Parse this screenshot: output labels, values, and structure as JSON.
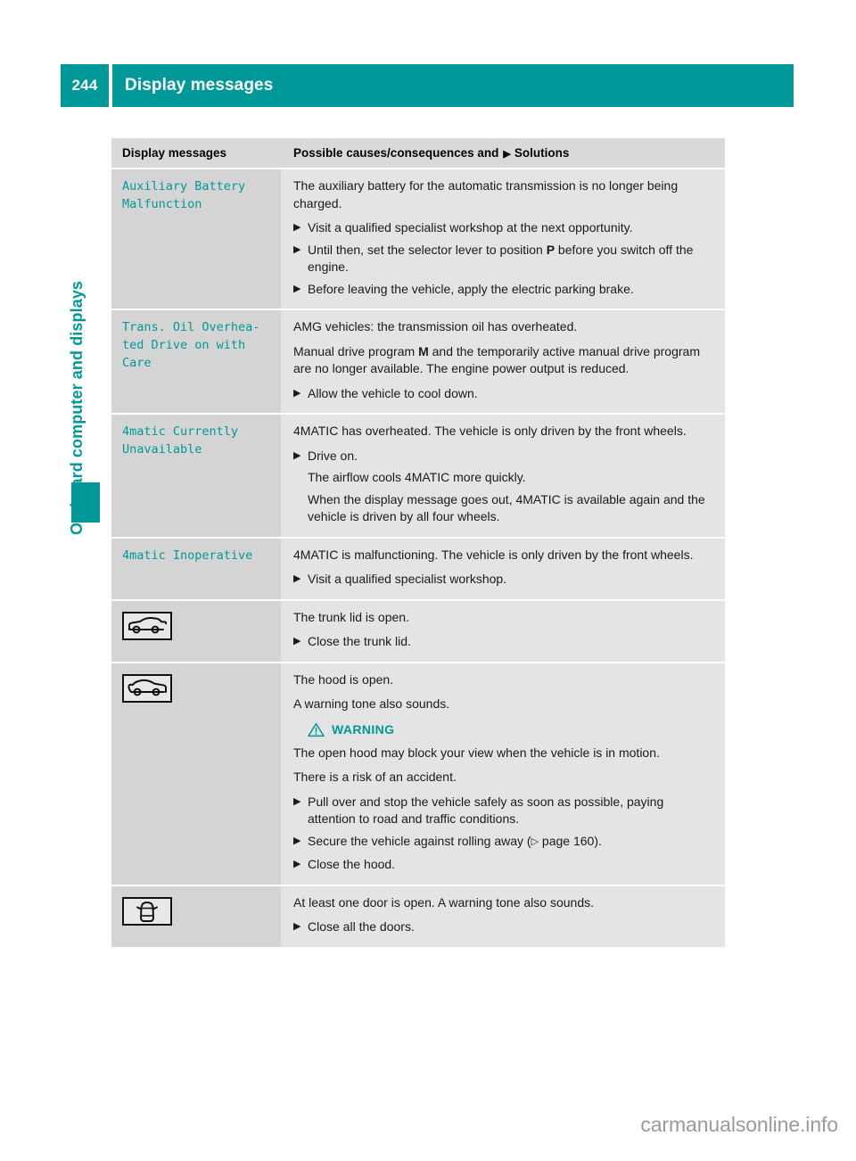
{
  "header": {
    "page_number": "244",
    "title": "Display messages",
    "accent_color": "#009898"
  },
  "sidebar": {
    "chapter_label": "On-board computer and displays",
    "marker_color": "#009898"
  },
  "table": {
    "columns": {
      "messages": "Display messages",
      "solutions_prefix": "Possible causes/consequences and",
      "solutions_suffix": "Solutions",
      "solutions_glyph": "▶"
    },
    "rows": [
      {
        "message": "Auxiliary Battery\nMalfunction",
        "icon": null,
        "blocks": [
          {
            "kind": "para",
            "text": "The auxiliary battery for the automatic transmission is no longer being charged."
          },
          {
            "kind": "bullet",
            "text": "Visit a qualified specialist workshop at the next opportunity."
          },
          {
            "kind": "bullet_rich",
            "pre": "Until then, set the selector lever to position ",
            "bold": "P",
            "post": " before you switch off the engine."
          },
          {
            "kind": "bullet",
            "text": "Before leaving the vehicle, apply the electric parking brake."
          }
        ]
      },
      {
        "message": "Trans. Oil Overhea-\nted Drive on with\nCare",
        "icon": null,
        "blocks": [
          {
            "kind": "para",
            "text": "AMG vehicles: the transmission oil has overheated."
          },
          {
            "kind": "para_rich",
            "pre": "Manual drive program ",
            "bold": "M",
            "post": " and the temporarily active manual drive program are no longer available. The engine power output is reduced."
          },
          {
            "kind": "bullet",
            "text": "Allow the vehicle to cool down."
          }
        ]
      },
      {
        "message": "4matic Currently\nUnavailable",
        "icon": null,
        "blocks": [
          {
            "kind": "para",
            "text": "4MATIC has overheated. The vehicle is only driven by the front wheels."
          },
          {
            "kind": "bullet",
            "text": "Drive on."
          },
          {
            "kind": "sub",
            "text": "The airflow cools 4MATIC more quickly."
          },
          {
            "kind": "sub",
            "text": "When the display message goes out, 4MATIC is available again and the vehicle is driven by all four wheels."
          }
        ]
      },
      {
        "message": "4matic Inoperative",
        "icon": null,
        "blocks": [
          {
            "kind": "para",
            "text": "4MATIC is malfunctioning. The vehicle is only driven by the front wheels."
          },
          {
            "kind": "bullet",
            "text": "Visit a qualified specialist workshop."
          }
        ]
      },
      {
        "message": null,
        "icon": "car-trunk-open-icon",
        "blocks": [
          {
            "kind": "para",
            "text": "The trunk lid is open."
          },
          {
            "kind": "bullet",
            "text": "Close the trunk lid."
          }
        ]
      },
      {
        "message": null,
        "icon": "car-hood-open-icon",
        "blocks": [
          {
            "kind": "para",
            "text": "The hood is open."
          },
          {
            "kind": "para",
            "text": "A warning tone also sounds."
          },
          {
            "kind": "warning",
            "label": "WARNING"
          },
          {
            "kind": "para",
            "text": "The open hood may block your view when the vehicle is in motion."
          },
          {
            "kind": "para",
            "text": "There is a risk of an accident."
          },
          {
            "kind": "bullet",
            "text": "Pull over and stop the vehicle safely as soon as possible, paying attention to road and traffic conditions."
          },
          {
            "kind": "bullet_pageref",
            "pre": "Secure the vehicle against rolling away (",
            "glyph": "▷",
            "page": " page 160)."
          },
          {
            "kind": "bullet",
            "text": "Close the hood."
          }
        ]
      },
      {
        "message": null,
        "icon": "car-door-open-icon",
        "blocks": [
          {
            "kind": "para",
            "text": "At least one door is open. A warning tone also sounds."
          },
          {
            "kind": "bullet",
            "text": "Close all the doors."
          }
        ]
      }
    ]
  },
  "footer": {
    "watermark": "carmanualsonline.info"
  }
}
